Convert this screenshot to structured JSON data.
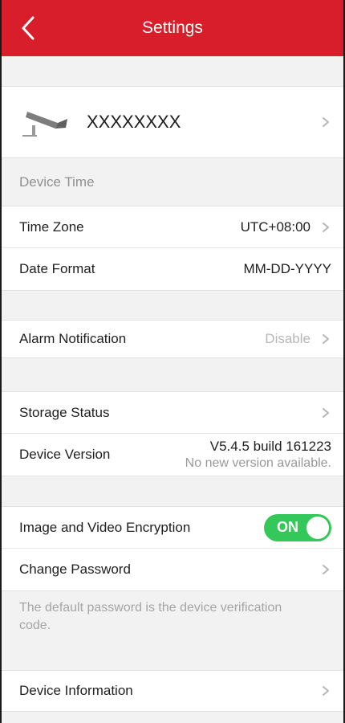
{
  "header": {
    "title": "Settings"
  },
  "device": {
    "name": "XXXXXXXX"
  },
  "device_time_header": "Device Time",
  "rows": {
    "time_zone": {
      "label": "Time Zone",
      "value": "UTC+08:00"
    },
    "date_format": {
      "label": "Date Format",
      "value": "MM-DD-YYYY"
    },
    "alarm_notification": {
      "label": "Alarm Notification",
      "value": "Disable"
    },
    "storage_status": {
      "label": "Storage Status"
    },
    "device_version": {
      "label": "Device Version",
      "value": "V5.4.5 build 161223",
      "subvalue": "No new version available."
    },
    "encryption": {
      "label": "Image and Video Encryption",
      "toggle": "ON"
    },
    "change_password": {
      "label": "Change Password"
    },
    "device_information": {
      "label": "Device Information"
    }
  },
  "help_text": "The default password is the device verification code."
}
